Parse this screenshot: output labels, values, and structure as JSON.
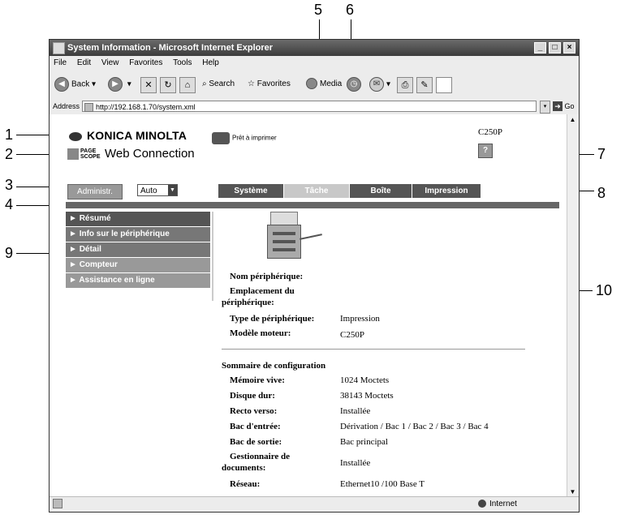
{
  "callouts": [
    "1",
    "2",
    "3",
    "4",
    "5",
    "6",
    "7",
    "8",
    "9",
    "10"
  ],
  "window": {
    "title": "System Information - Microsoft Internet Explorer",
    "menu": [
      "File",
      "Edit",
      "View",
      "Favorites",
      "Tools",
      "Help"
    ],
    "toolbar": {
      "back": "Back",
      "search": "Search",
      "favorites": "Favorites",
      "media": "Media"
    },
    "address_label": "Address",
    "address_url": "http://192.168.1.70/system.xml",
    "go_label": "Go",
    "status_zone": "Internet"
  },
  "page": {
    "brand": "KONICA MINOLTA",
    "pagescope": "PAGE SCOPE",
    "web_connection": "Web Connection",
    "printer_status": "Prêt à imprimer",
    "model": "C250P",
    "help_icon": "?",
    "admin_button": "Administr.",
    "display_mode": "Auto",
    "tabs": [
      "Système",
      "Tâche",
      "Boîte",
      "Impression"
    ],
    "side_menu": [
      "Résumé",
      "Info sur le périphérique",
      "Détail",
      "Compteur",
      "Assistance en ligne"
    ],
    "device_info": {
      "name_label": "Nom périphérique:",
      "location_label_1": "Emplacement du",
      "location_label_2": "périphérique:",
      "type_label": "Type de périphérique:",
      "type_value": "Impression",
      "engine_label": "Modèle moteur:",
      "engine_value": "C250P"
    },
    "config": {
      "heading": "Sommaire de configuration",
      "rows": [
        {
          "label": "Mémoire vive:",
          "value": "1024 Moctets"
        },
        {
          "label": "Disque dur:",
          "value": "38143 Moctets"
        },
        {
          "label": "Recto verso:",
          "value": "Installée"
        },
        {
          "label": "Bac d'entrée:",
          "value": "Dérivation / Bac 1 / Bac 2 / Bac 3 / Bac 4"
        },
        {
          "label": "Bac de sortie:",
          "value": "Bac principal"
        },
        {
          "label_1": "Gestionnaire de",
          "label_2": "documents:",
          "value": "Installée"
        },
        {
          "label": "Réseau:",
          "value": "Ethernet10 /100 Base T"
        }
      ]
    }
  }
}
